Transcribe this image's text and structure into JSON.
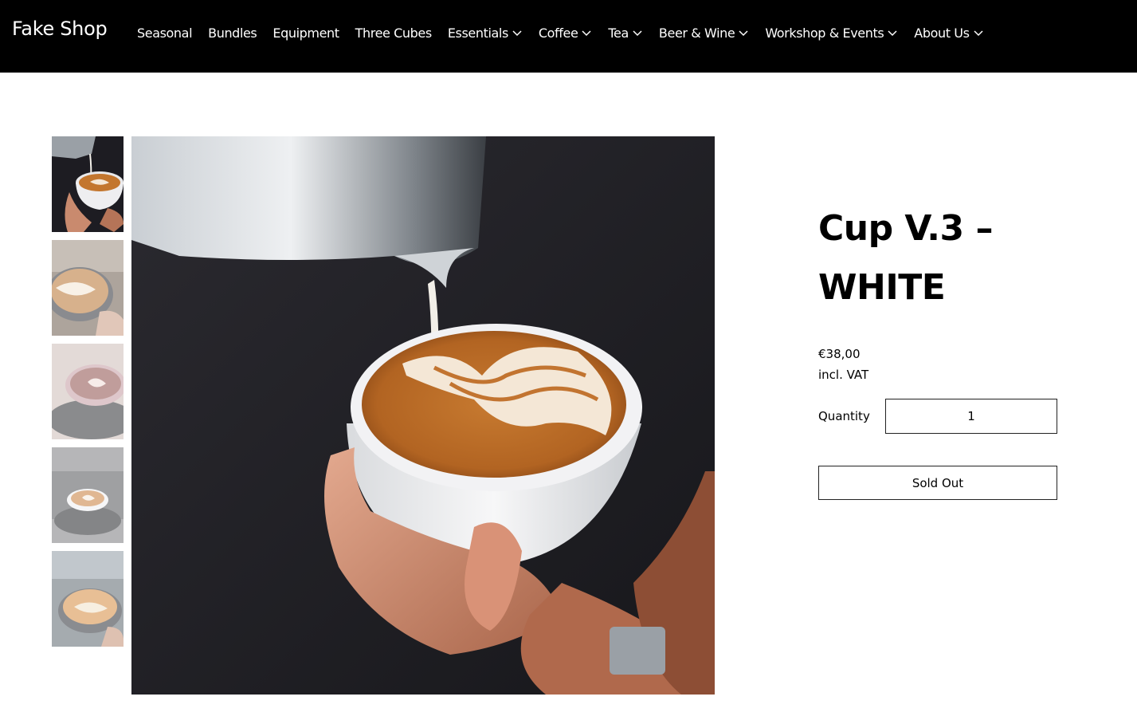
{
  "header": {
    "logo": "Fake Shop",
    "nav": [
      {
        "label": "Seasonal",
        "has_dropdown": false
      },
      {
        "label": "Bundles",
        "has_dropdown": false
      },
      {
        "label": "Equipment",
        "has_dropdown": false
      },
      {
        "label": "Three Cubes",
        "has_dropdown": false
      },
      {
        "label": "Essentials",
        "has_dropdown": true,
        "icon": "chevron-down-icon"
      },
      {
        "label": "Coffee",
        "has_dropdown": true,
        "icon": "chevron-down-icon"
      },
      {
        "label": "Tea",
        "has_dropdown": true,
        "icon": "chevron-down-icon"
      },
      {
        "label": "Beer & Wine",
        "has_dropdown": true,
        "icon": "chevron-down-icon"
      },
      {
        "label": "Workshop & Events",
        "has_dropdown": true,
        "icon": "chevron-down-icon"
      },
      {
        "label": "About Us",
        "has_dropdown": true,
        "icon": "chevron-down-icon"
      }
    ]
  },
  "gallery": {
    "selected_index": 0,
    "thumbnails": [
      {
        "subject": "latte-art-pour"
      },
      {
        "subject": "latte-art-cup-closeup"
      },
      {
        "subject": "latte-art-pink-cup"
      },
      {
        "subject": "latte-on-saucer"
      },
      {
        "subject": "latte-art-hand-stirring"
      }
    ],
    "main_image": {
      "subject": "latte-art-pour"
    }
  },
  "product": {
    "title": "Cup V.3 – WHITE",
    "price": "€38,00",
    "vat_note": "incl. VAT",
    "quantity_label": "Quantity",
    "quantity_value": "1",
    "sold_out_label": "Sold Out"
  },
  "colors": {
    "header_bg": "#000000",
    "header_text": "#ffffff",
    "page_bg": "#ffffff",
    "border": "#222222"
  }
}
